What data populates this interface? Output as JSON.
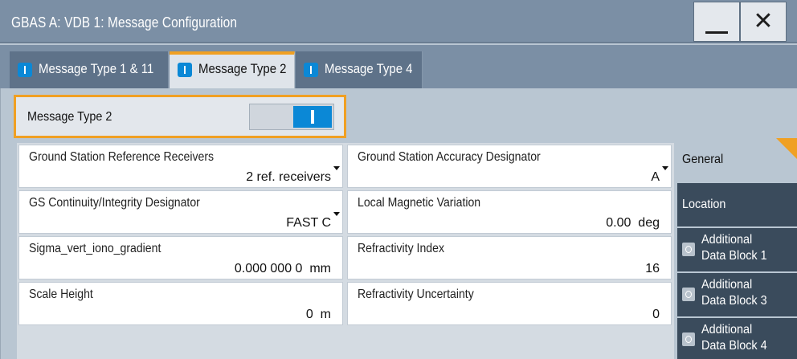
{
  "window": {
    "title": "GBAS A: VDB 1: Message Configuration",
    "minimize_glyph": "—",
    "close_glyph": "✕"
  },
  "tabs": [
    {
      "label": "Message Type 1 & 11",
      "active": false
    },
    {
      "label": "Message Type 2",
      "active": true
    },
    {
      "label": "Message Type 4",
      "active": false
    }
  ],
  "toggle": {
    "label": "Message Type 2",
    "state": "on"
  },
  "fields": {
    "gs_ref_receivers": {
      "label": "Ground Station Reference Receivers",
      "value": "2 ref. receivers"
    },
    "gs_accuracy": {
      "label": "Ground Station Accuracy Designator",
      "value": "A"
    },
    "gs_continuity": {
      "label": "GS Continuity/Integrity Designator",
      "value": "FAST C"
    },
    "local_mag_var": {
      "label": "Local Magnetic Variation",
      "value": "0.00  deg"
    },
    "sigma_vert": {
      "label": "Sigma_vert_iono_gradient",
      "value": "0.000 000 0  mm"
    },
    "refractivity_index": {
      "label": "Refractivity Index",
      "value": "16"
    },
    "scale_height": {
      "label": "Scale Height",
      "value": "0  m"
    },
    "refractivity_uncertainty": {
      "label": "Refractivity Uncertainty",
      "value": "0"
    }
  },
  "sidenav": {
    "general": "General",
    "location": "Location",
    "adb1": [
      "Additional",
      "Data Block 1"
    ],
    "adb3": [
      "Additional",
      "Data Block 3"
    ],
    "adb4": [
      "Additional",
      "Data Block 4"
    ]
  },
  "colors": {
    "accent_orange": "#f0a023",
    "accent_blue": "#0b88d6",
    "titlebar": "#7b8fa5",
    "nav_dark": "#3a4b5c"
  }
}
